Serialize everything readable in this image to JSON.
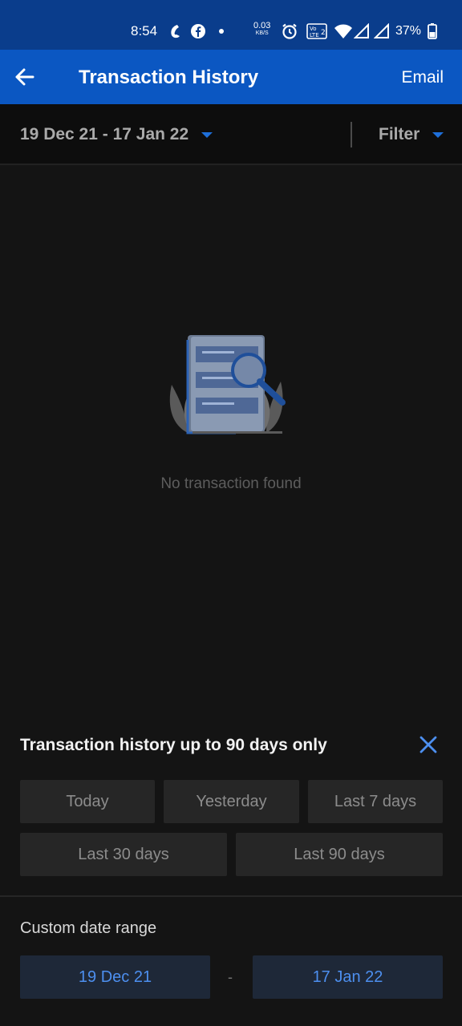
{
  "status_bar": {
    "time": "8:54",
    "data_speed": "0.03",
    "data_unit": "KB/S",
    "battery": "37%",
    "icons": [
      "custom-app-icon",
      "facebook-icon",
      "dot-icon",
      "alarm-icon",
      "volte-icon",
      "wifi-icon",
      "signal-icon",
      "signal-icon",
      "battery-icon"
    ]
  },
  "app_bar": {
    "title": "Transaction History",
    "email_label": "Email"
  },
  "range_bar": {
    "date_range": "19 Dec 21 - 17 Jan 22",
    "filter_label": "Filter"
  },
  "empty_state": {
    "message": "No transaction found"
  },
  "sheet": {
    "title": "Transaction history up to 90 days only",
    "quick_ranges": [
      "Today",
      "Yesterday",
      "Last 7 days",
      "Last 30 days",
      "Last 90 days"
    ],
    "custom_label": "Custom date range",
    "from_date": "19 Dec 21",
    "separator": "-",
    "to_date": "17 Jan 22"
  },
  "colors": {
    "status_bar": "#0a3d8c",
    "app_bar": "#0b57c2",
    "accent": "#1e6fd9",
    "background": "#141414"
  }
}
